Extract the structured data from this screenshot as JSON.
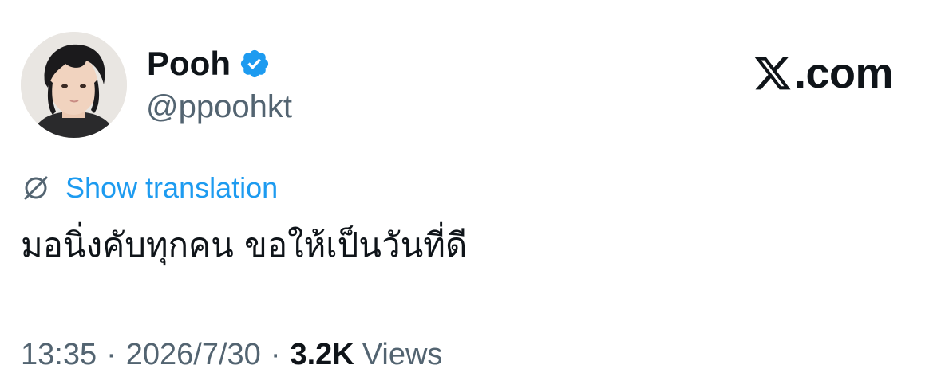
{
  "author": {
    "display_name": "Pooh",
    "handle": "@ppoohkt",
    "verified": true,
    "verified_color": "#1d9bf0",
    "avatar_icon": "profile-photo"
  },
  "brand": {
    "text": ".com",
    "logo_icon": "x-logo-icon"
  },
  "translation": {
    "label": "Show translation",
    "icon": "globe-slash-icon",
    "color": "#1d9bf0"
  },
  "tweet": {
    "text": "มอนิ่งคับทุกคน ขอให้เป็นวันที่ดี"
  },
  "meta": {
    "time": "13:35",
    "separator": "·",
    "date": "2026/7/30",
    "views_count": "3.2K",
    "views_label": "Views"
  },
  "colors": {
    "text_primary": "#0f1419",
    "text_secondary": "#536471",
    "accent": "#1d9bf0"
  }
}
